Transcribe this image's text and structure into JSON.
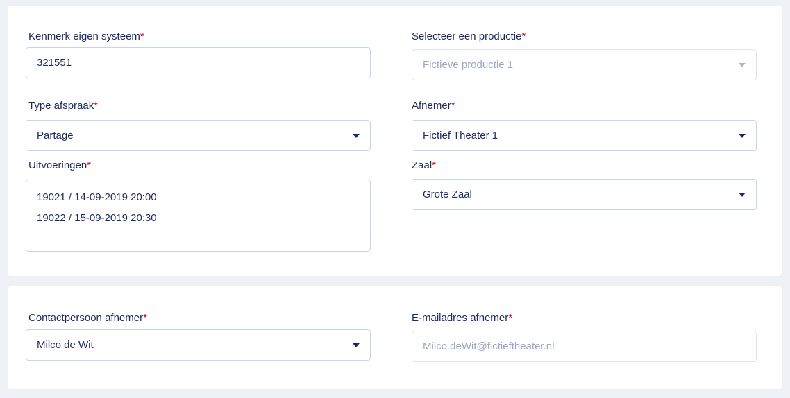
{
  "section1": {
    "kenmerk": {
      "label": "Kenmerk eigen systeem",
      "value": "321551"
    },
    "productie": {
      "label": "Selecteer een productie",
      "value": "Fictieve productie 1"
    },
    "type_afspraak": {
      "label": "Type afspraak",
      "value": "Partage"
    },
    "afnemer": {
      "label": "Afnemer",
      "value": "Fictief Theater 1"
    },
    "uitvoeringen": {
      "label": "Uitvoeringen",
      "items": [
        "19021 / 14-09-2019 20:00",
        "19022 / 15-09-2019 20:30"
      ]
    },
    "zaal": {
      "label": "Zaal",
      "value": "Grote Zaal"
    }
  },
  "section2": {
    "contactpersoon": {
      "label": "Contactpersoon afnemer",
      "value": "Milco de Wit"
    },
    "email": {
      "label": "E-mailadres afnemer",
      "placeholder": "Milco.deWit@fictieftheater.nl"
    }
  },
  "required_marker": "*",
  "icons": {
    "dropdown": "caret-down-icon"
  },
  "colors": {
    "text": "#1c2a5e",
    "required": "#d0021b",
    "border": "#c6d4ee",
    "muted": "#9aa6c3",
    "background": "#eef1f6"
  }
}
